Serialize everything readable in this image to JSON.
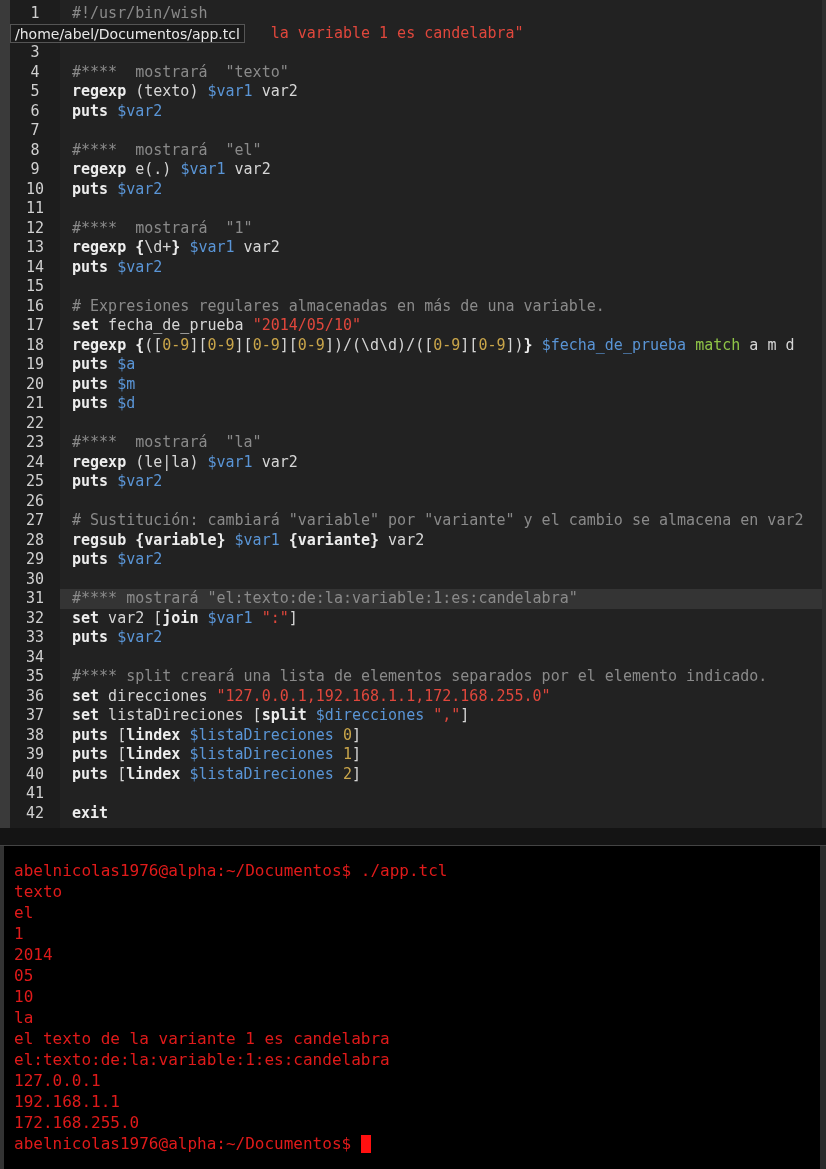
{
  "editor": {
    "tooltip": "/home/abel/Documentos/app.tcl",
    "lines": [
      {
        "number": "1",
        "current": false,
        "covered": false,
        "tokens": [
          {
            "kind": "comment",
            "text": "#!/usr/bin/wish"
          }
        ]
      },
      {
        "current": false,
        "covered": true,
        "tokens": [
          {
            "kind": "string",
            "text": "la variable 1 es candelabra\""
          }
        ]
      },
      {
        "number": "3",
        "current": false,
        "covered": false
      },
      {
        "number": "4",
        "current": false,
        "covered": false,
        "tokens": [
          {
            "kind": "comment",
            "text": "#****  mostrará  \"texto\""
          }
        ]
      },
      {
        "number": "5",
        "current": false,
        "covered": false,
        "tokens": [
          {
            "kind": "keyword",
            "text": "regexp"
          },
          {
            "kind": "plain",
            "text": " (texto) "
          },
          {
            "kind": "variable",
            "text": "$var1"
          },
          {
            "kind": "plain",
            "text": " var2"
          }
        ]
      },
      {
        "number": "6",
        "current": false,
        "covered": false,
        "tokens": [
          {
            "kind": "keyword",
            "text": "puts "
          },
          {
            "kind": "variable",
            "text": "$var2"
          }
        ]
      },
      {
        "number": "7",
        "current": false,
        "covered": false
      },
      {
        "number": "8",
        "current": false,
        "covered": false,
        "tokens": [
          {
            "kind": "comment",
            "text": "#****  mostrará  \"el\""
          }
        ]
      },
      {
        "number": "9",
        "current": false,
        "covered": false,
        "tokens": [
          {
            "kind": "keyword",
            "text": "regexp"
          },
          {
            "kind": "plain",
            "text": " e(.) "
          },
          {
            "kind": "variable",
            "text": "$var1"
          },
          {
            "kind": "plain",
            "text": " var2"
          }
        ]
      },
      {
        "number": "10",
        "current": false,
        "covered": false,
        "tokens": [
          {
            "kind": "keyword",
            "text": "puts "
          },
          {
            "kind": "variable",
            "text": "$var2"
          }
        ]
      },
      {
        "number": "11",
        "current": false,
        "covered": false
      },
      {
        "number": "12",
        "current": false,
        "covered": false,
        "tokens": [
          {
            "kind": "comment",
            "text": "#****  mostrará  \"1\""
          }
        ]
      },
      {
        "number": "13",
        "current": false,
        "covered": false,
        "tokens": [
          {
            "kind": "keyword",
            "text": "regexp {"
          },
          {
            "kind": "plain",
            "text": "\\d+"
          },
          {
            "kind": "keyword",
            "text": "} "
          },
          {
            "kind": "variable",
            "text": "$var1"
          },
          {
            "kind": "plain",
            "text": " var2"
          }
        ]
      },
      {
        "number": "14",
        "current": false,
        "covered": false,
        "tokens": [
          {
            "kind": "keyword",
            "text": "puts "
          },
          {
            "kind": "variable",
            "text": "$var2"
          }
        ]
      },
      {
        "number": "15",
        "current": false,
        "covered": false
      },
      {
        "number": "16",
        "current": false,
        "covered": false,
        "tokens": [
          {
            "kind": "comment",
            "text": "# Expresiones regulares almacenadas en más de una variable."
          }
        ]
      },
      {
        "number": "17",
        "current": false,
        "covered": false,
        "tokens": [
          {
            "kind": "keyword",
            "text": "set"
          },
          {
            "kind": "plain",
            "text": " fecha_de_prueba "
          },
          {
            "kind": "string",
            "text": "\"2014/05/10\""
          }
        ]
      },
      {
        "number": "18",
        "current": false,
        "covered": false,
        "tokens": [
          {
            "kind": "keyword",
            "text": "regexp {"
          },
          {
            "kind": "plain",
            "text": "(["
          },
          {
            "kind": "number",
            "text": "0-9"
          },
          {
            "kind": "plain",
            "text": "]["
          },
          {
            "kind": "number",
            "text": "0-9"
          },
          {
            "kind": "plain",
            "text": "]["
          },
          {
            "kind": "number",
            "text": "0-9"
          },
          {
            "kind": "plain",
            "text": "]["
          },
          {
            "kind": "number",
            "text": "0-9"
          },
          {
            "kind": "plain",
            "text": "])/(\\d\\d)/(["
          },
          {
            "kind": "number",
            "text": "0-9"
          },
          {
            "kind": "plain",
            "text": "]["
          },
          {
            "kind": "number",
            "text": "0-9"
          },
          {
            "kind": "plain",
            "text": "])"
          },
          {
            "kind": "keyword",
            "text": "} "
          },
          {
            "kind": "variable",
            "text": "$fecha_de_prueba "
          },
          {
            "kind": "option",
            "text": "match"
          },
          {
            "kind": "plain",
            "text": " a m d"
          }
        ]
      },
      {
        "number": "19",
        "current": false,
        "covered": false,
        "tokens": [
          {
            "kind": "keyword",
            "text": "puts "
          },
          {
            "kind": "variable",
            "text": "$a"
          }
        ]
      },
      {
        "number": "20",
        "current": false,
        "covered": false,
        "tokens": [
          {
            "kind": "keyword",
            "text": "puts "
          },
          {
            "kind": "variable",
            "text": "$m"
          }
        ]
      },
      {
        "number": "21",
        "current": false,
        "covered": false,
        "tokens": [
          {
            "kind": "keyword",
            "text": "puts "
          },
          {
            "kind": "variable",
            "text": "$d"
          }
        ]
      },
      {
        "number": "22",
        "current": false,
        "covered": false
      },
      {
        "number": "23",
        "current": false,
        "covered": false,
        "tokens": [
          {
            "kind": "comment",
            "text": "#****  mostrará  \"la\""
          }
        ]
      },
      {
        "number": "24",
        "current": false,
        "covered": false,
        "tokens": [
          {
            "kind": "keyword",
            "text": "regexp"
          },
          {
            "kind": "plain",
            "text": " (le|la) "
          },
          {
            "kind": "variable",
            "text": "$var1"
          },
          {
            "kind": "plain",
            "text": " var2"
          }
        ]
      },
      {
        "number": "25",
        "current": false,
        "covered": false,
        "tokens": [
          {
            "kind": "keyword",
            "text": "puts "
          },
          {
            "kind": "variable",
            "text": "$var2"
          }
        ]
      },
      {
        "number": "26",
        "current": false,
        "covered": false
      },
      {
        "number": "27",
        "current": false,
        "covered": false,
        "tokens": [
          {
            "kind": "comment",
            "text": "# Sustitución: cambiará \"variable\" por \"variante\" y el cambio se almacena en var2"
          }
        ]
      },
      {
        "number": "28",
        "current": false,
        "covered": false,
        "tokens": [
          {
            "kind": "keyword",
            "text": "regsub {variable} "
          },
          {
            "kind": "variable",
            "text": "$var1 "
          },
          {
            "kind": "keyword",
            "text": "{variante}"
          },
          {
            "kind": "plain",
            "text": " var2"
          }
        ]
      },
      {
        "number": "29",
        "current": false,
        "covered": false,
        "tokens": [
          {
            "kind": "keyword",
            "text": "puts "
          },
          {
            "kind": "variable",
            "text": "$var2"
          }
        ]
      },
      {
        "number": "30",
        "current": false,
        "covered": false
      },
      {
        "number": "31",
        "current": true,
        "covered": false,
        "tokens": [
          {
            "kind": "comment",
            "text": "#**** mostrará \"el:texto:de:la:variable:1:es:candelabra\""
          }
        ]
      },
      {
        "number": "32",
        "current": false,
        "covered": false,
        "tokens": [
          {
            "kind": "keyword",
            "text": "set"
          },
          {
            "kind": "plain",
            "text": " var2 ["
          },
          {
            "kind": "keyword",
            "text": "join "
          },
          {
            "kind": "variable",
            "text": "$var1 "
          },
          {
            "kind": "string",
            "text": "\":\""
          },
          {
            "kind": "plain",
            "text": "]"
          }
        ]
      },
      {
        "number": "33",
        "current": false,
        "covered": false,
        "tokens": [
          {
            "kind": "keyword",
            "text": "puts "
          },
          {
            "kind": "variable",
            "text": "$var2"
          }
        ]
      },
      {
        "number": "34",
        "current": false,
        "covered": false
      },
      {
        "number": "35",
        "current": false,
        "covered": false,
        "tokens": [
          {
            "kind": "comment",
            "text": "#**** split creará una lista de elementos separados por el elemento indicado."
          }
        ]
      },
      {
        "number": "36",
        "current": false,
        "covered": false,
        "tokens": [
          {
            "kind": "keyword",
            "text": "set"
          },
          {
            "kind": "plain",
            "text": " direcciones "
          },
          {
            "kind": "string",
            "text": "\"127.0.0.1,192.168.1.1,172.168.255.0\""
          }
        ]
      },
      {
        "number": "37",
        "current": false,
        "covered": false,
        "tokens": [
          {
            "kind": "keyword",
            "text": "set"
          },
          {
            "kind": "plain",
            "text": " listaDireciones ["
          },
          {
            "kind": "keyword",
            "text": "split "
          },
          {
            "kind": "variable",
            "text": "$direcciones "
          },
          {
            "kind": "string",
            "text": "\",\""
          },
          {
            "kind": "plain",
            "text": "]"
          }
        ]
      },
      {
        "number": "38",
        "current": false,
        "covered": false,
        "tokens": [
          {
            "kind": "keyword",
            "text": "puts"
          },
          {
            "kind": "plain",
            "text": " ["
          },
          {
            "kind": "keyword",
            "text": "lindex "
          },
          {
            "kind": "variable",
            "text": "$listaDireciones "
          },
          {
            "kind": "number",
            "text": "0"
          },
          {
            "kind": "plain",
            "text": "]"
          }
        ]
      },
      {
        "number": "39",
        "current": false,
        "covered": false,
        "tokens": [
          {
            "kind": "keyword",
            "text": "puts"
          },
          {
            "kind": "plain",
            "text": " ["
          },
          {
            "kind": "keyword",
            "text": "lindex "
          },
          {
            "kind": "variable",
            "text": "$listaDireciones "
          },
          {
            "kind": "number",
            "text": "1"
          },
          {
            "kind": "plain",
            "text": "]"
          }
        ]
      },
      {
        "number": "40",
        "current": false,
        "covered": false,
        "tokens": [
          {
            "kind": "keyword",
            "text": "puts"
          },
          {
            "kind": "plain",
            "text": " ["
          },
          {
            "kind": "keyword",
            "text": "lindex "
          },
          {
            "kind": "variable",
            "text": "$listaDireciones "
          },
          {
            "kind": "number",
            "text": "2"
          },
          {
            "kind": "plain",
            "text": "]"
          }
        ]
      },
      {
        "number": "41",
        "current": false,
        "covered": false
      },
      {
        "number": "42",
        "current": false,
        "covered": false,
        "tokens": [
          {
            "kind": "keyword",
            "text": "exit"
          }
        ]
      }
    ]
  },
  "terminal": {
    "lines": [
      {
        "text": "abelnicolas1976@alpha:~/Documentos$ ./app.tcl",
        "cursor": false
      },
      {
        "text": "texto",
        "cursor": false
      },
      {
        "text": "el",
        "cursor": false
      },
      {
        "text": "1",
        "cursor": false
      },
      {
        "text": "2014",
        "cursor": false
      },
      {
        "text": "05",
        "cursor": false
      },
      {
        "text": "10",
        "cursor": false
      },
      {
        "text": "la",
        "cursor": false
      },
      {
        "text": "el texto de la variante 1 es candelabra",
        "cursor": false
      },
      {
        "text": "el:texto:de:la:variable:1:es:candelabra",
        "cursor": false
      },
      {
        "text": "127.0.0.1",
        "cursor": false
      },
      {
        "text": "192.168.1.1",
        "cursor": false
      },
      {
        "text": "172.168.255.0",
        "cursor": false
      },
      {
        "text": "abelnicolas1976@alpha:~/Documentos$",
        "cursor": true
      }
    ]
  }
}
